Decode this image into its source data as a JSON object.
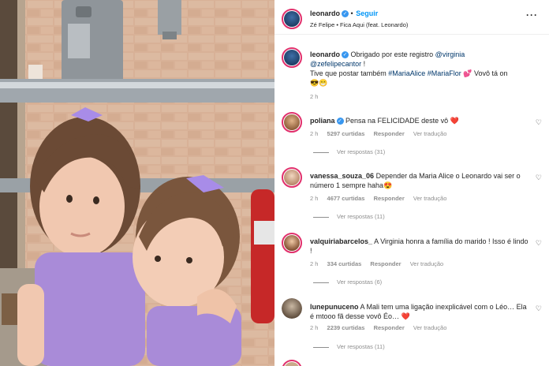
{
  "post": {
    "author": "leonardo",
    "follow_label": "Seguir",
    "audio": "Zé Felipe • Fica Aqui (feat. Leonardo)",
    "more_icon": "more-horizontal-icon"
  },
  "caption": {
    "author": "leonardo",
    "text_before": "Obrigado por este registro ",
    "mention_1": "@virginia",
    "mention_2": "@zefelipecantor",
    "text_after_mention": " !",
    "line_2_start": "Tive que postar também ",
    "tag_1": "#MariaAlice",
    "tag_2": "#MariaFlor",
    "line_2_end": " 💕  Vovô tá on",
    "emojis": "😎😁",
    "time": "2 h"
  },
  "comments": [
    {
      "user": "poliana",
      "verified": true,
      "text": "Pensa na FELICIDADE deste vô ❤️",
      "time": "2 h",
      "likes": "5297 curtidas",
      "reply_label": "Responder",
      "translate_label": "Ver tradução",
      "replies": "Ver respostas (31)"
    },
    {
      "user": "vanessa_souza_06",
      "verified": false,
      "text": "Depender da Maria Alice o Leonardo vai ser o número 1 sempre haha😍",
      "time": "2 h",
      "likes": "4677 curtidas",
      "reply_label": "Responder",
      "translate_label": "Ver tradução",
      "replies": "Ver respostas (11)"
    },
    {
      "user": "valquiriabarcelos_",
      "verified": false,
      "text": "A Virginia honra a família do marido ! Isso é lindo !",
      "time": "2 h",
      "likes": "334 curtidas",
      "reply_label": "Responder",
      "translate_label": "Ver tradução",
      "replies": "Ver respostas (6)"
    },
    {
      "user": "lunepunuceno",
      "verified": false,
      "text": "A Mali tem uma ligação inexplicável com o Léo… Ela é mtooo fã desse vovô Éo… ❤️",
      "time": "2 h",
      "likes": "2239 curtidas",
      "reply_label": "Responder",
      "translate_label": "Ver tradução",
      "replies": "Ver respostas (11)"
    }
  ],
  "colors": {
    "verified": "#3897f0",
    "link": "#00376b",
    "follow": "#0095f6",
    "muted": "#8e8e8e",
    "story_ring": "#e1306c"
  }
}
